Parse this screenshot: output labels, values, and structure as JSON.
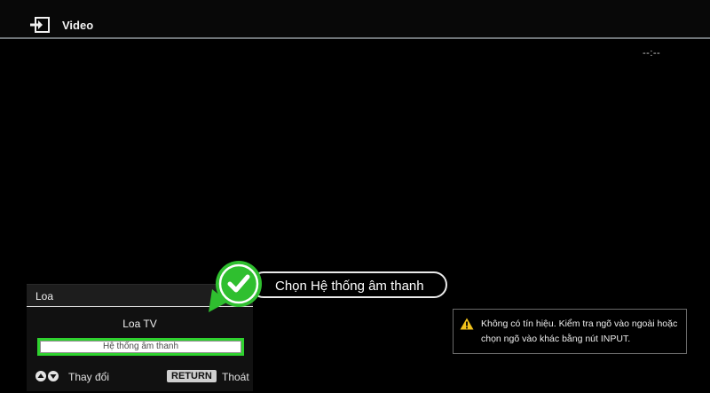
{
  "header": {
    "title": "Video",
    "icon": "input-source-icon"
  },
  "clock": "--:--",
  "speaker_panel": {
    "title": "Loa",
    "options": [
      {
        "label": "Loa TV",
        "selected": false
      },
      {
        "label": "Hệ thống âm thanh",
        "selected": true
      }
    ],
    "footer": {
      "change_label": "Thay đổi",
      "return_button": "RETURN",
      "exit_label": "Thoát"
    },
    "highlight_color": "#2fd22f"
  },
  "callout": {
    "text": "Chọn Hệ thống âm thanh",
    "icon": "check-icon",
    "color": "#2fbf2f"
  },
  "warning": {
    "icon": "warning-icon",
    "message": "Không có tín hiệu. Kiểm tra ngõ vào ngoài hoặc chọn ngõ vào khác bằng nút INPUT."
  }
}
